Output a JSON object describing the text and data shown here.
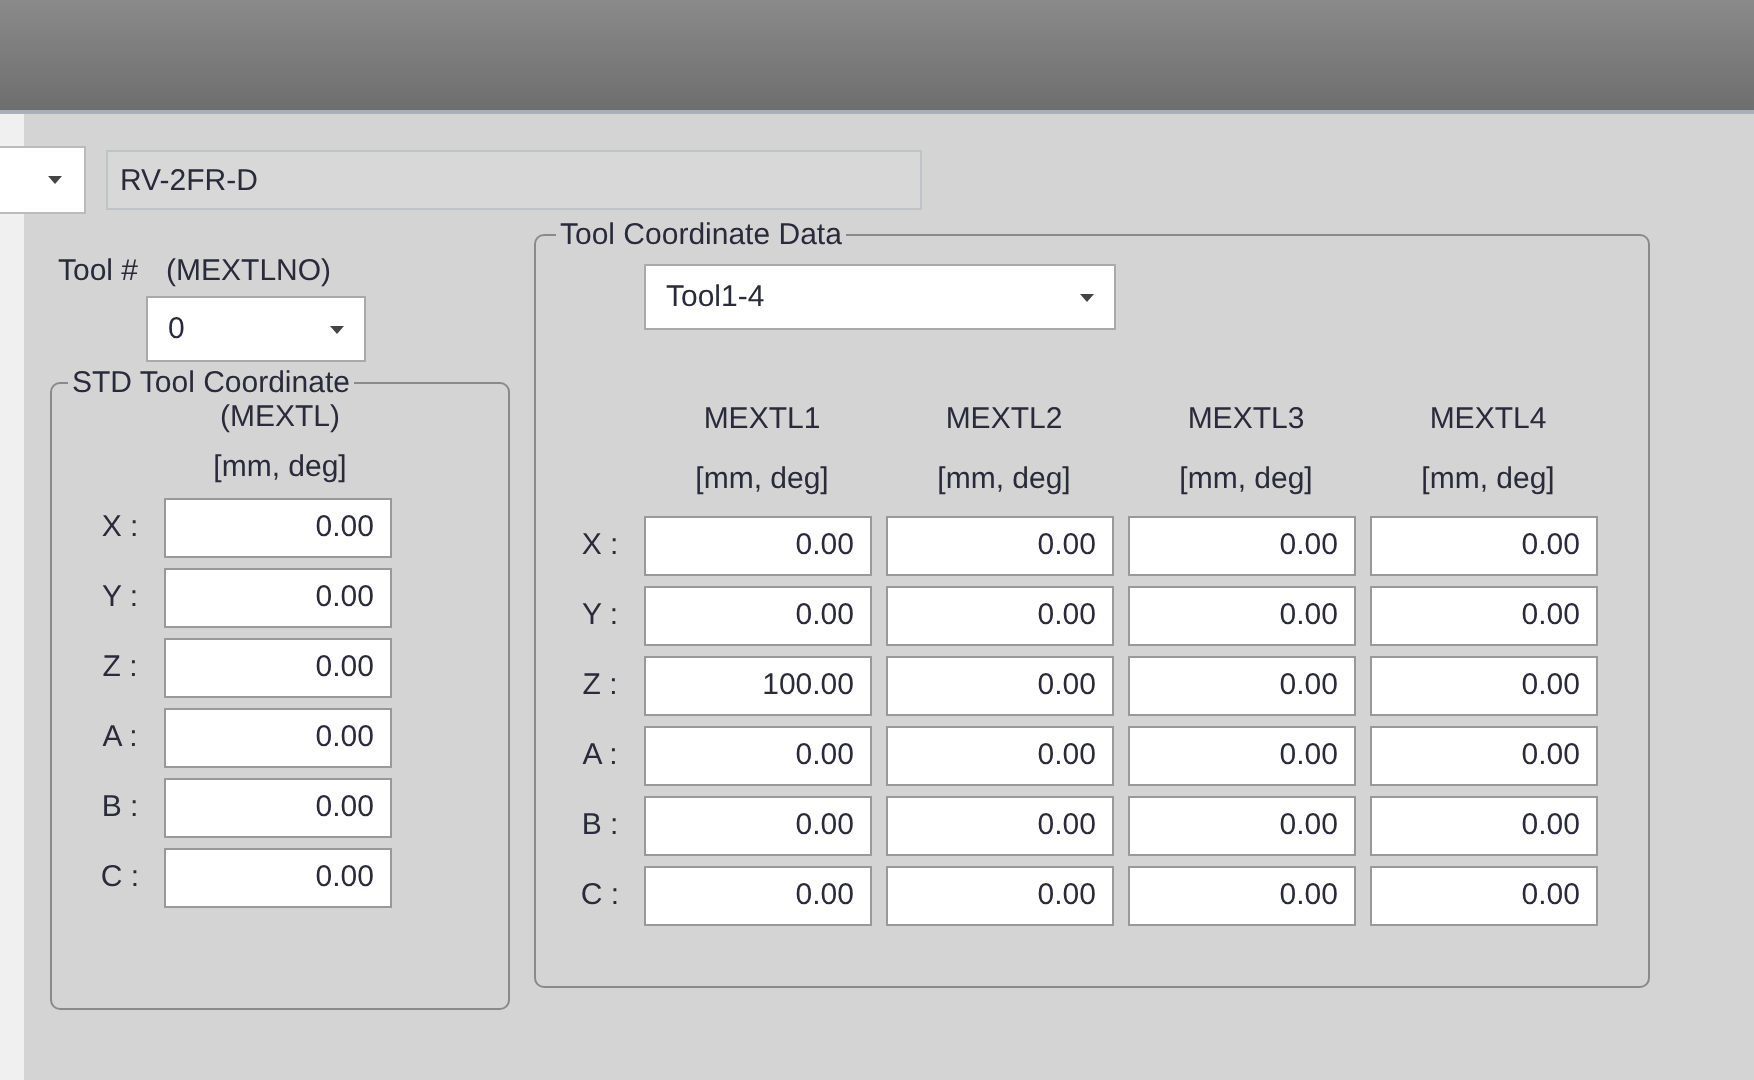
{
  "model_field": {
    "value": "RV-2FR-D"
  },
  "tool_number": {
    "label": "Tool #",
    "param": "(MEXTLNO)",
    "value": "0"
  },
  "std_group": {
    "title": "STD Tool Coordinate",
    "param": "(MEXTL)",
    "unit": "[mm, deg]",
    "rows": [
      {
        "axis": "X :",
        "value": "0.00"
      },
      {
        "axis": "Y :",
        "value": "0.00"
      },
      {
        "axis": "Z :",
        "value": "0.00"
      },
      {
        "axis": "A :",
        "value": "0.00"
      },
      {
        "axis": "B :",
        "value": "0.00"
      },
      {
        "axis": "C :",
        "value": "0.00"
      }
    ]
  },
  "data_group": {
    "title": "Tool Coordinate Data",
    "selector": "Tool1-4",
    "columns": [
      {
        "name": "MEXTL1",
        "unit": "[mm, deg]"
      },
      {
        "name": "MEXTL2",
        "unit": "[mm, deg]"
      },
      {
        "name": "MEXTL3",
        "unit": "[mm, deg]"
      },
      {
        "name": "MEXTL4",
        "unit": "[mm, deg]"
      }
    ],
    "rows": [
      {
        "axis": "X :",
        "values": [
          "0.00",
          "0.00",
          "0.00",
          "0.00"
        ]
      },
      {
        "axis": "Y :",
        "values": [
          "0.00",
          "0.00",
          "0.00",
          "0.00"
        ]
      },
      {
        "axis": "Z :",
        "values": [
          "100.00",
          "0.00",
          "0.00",
          "0.00"
        ]
      },
      {
        "axis": "A :",
        "values": [
          "0.00",
          "0.00",
          "0.00",
          "0.00"
        ]
      },
      {
        "axis": "B :",
        "values": [
          "0.00",
          "0.00",
          "0.00",
          "0.00"
        ]
      },
      {
        "axis": "C :",
        "values": [
          "0.00",
          "0.00",
          "0.00",
          "0.00"
        ]
      }
    ]
  }
}
